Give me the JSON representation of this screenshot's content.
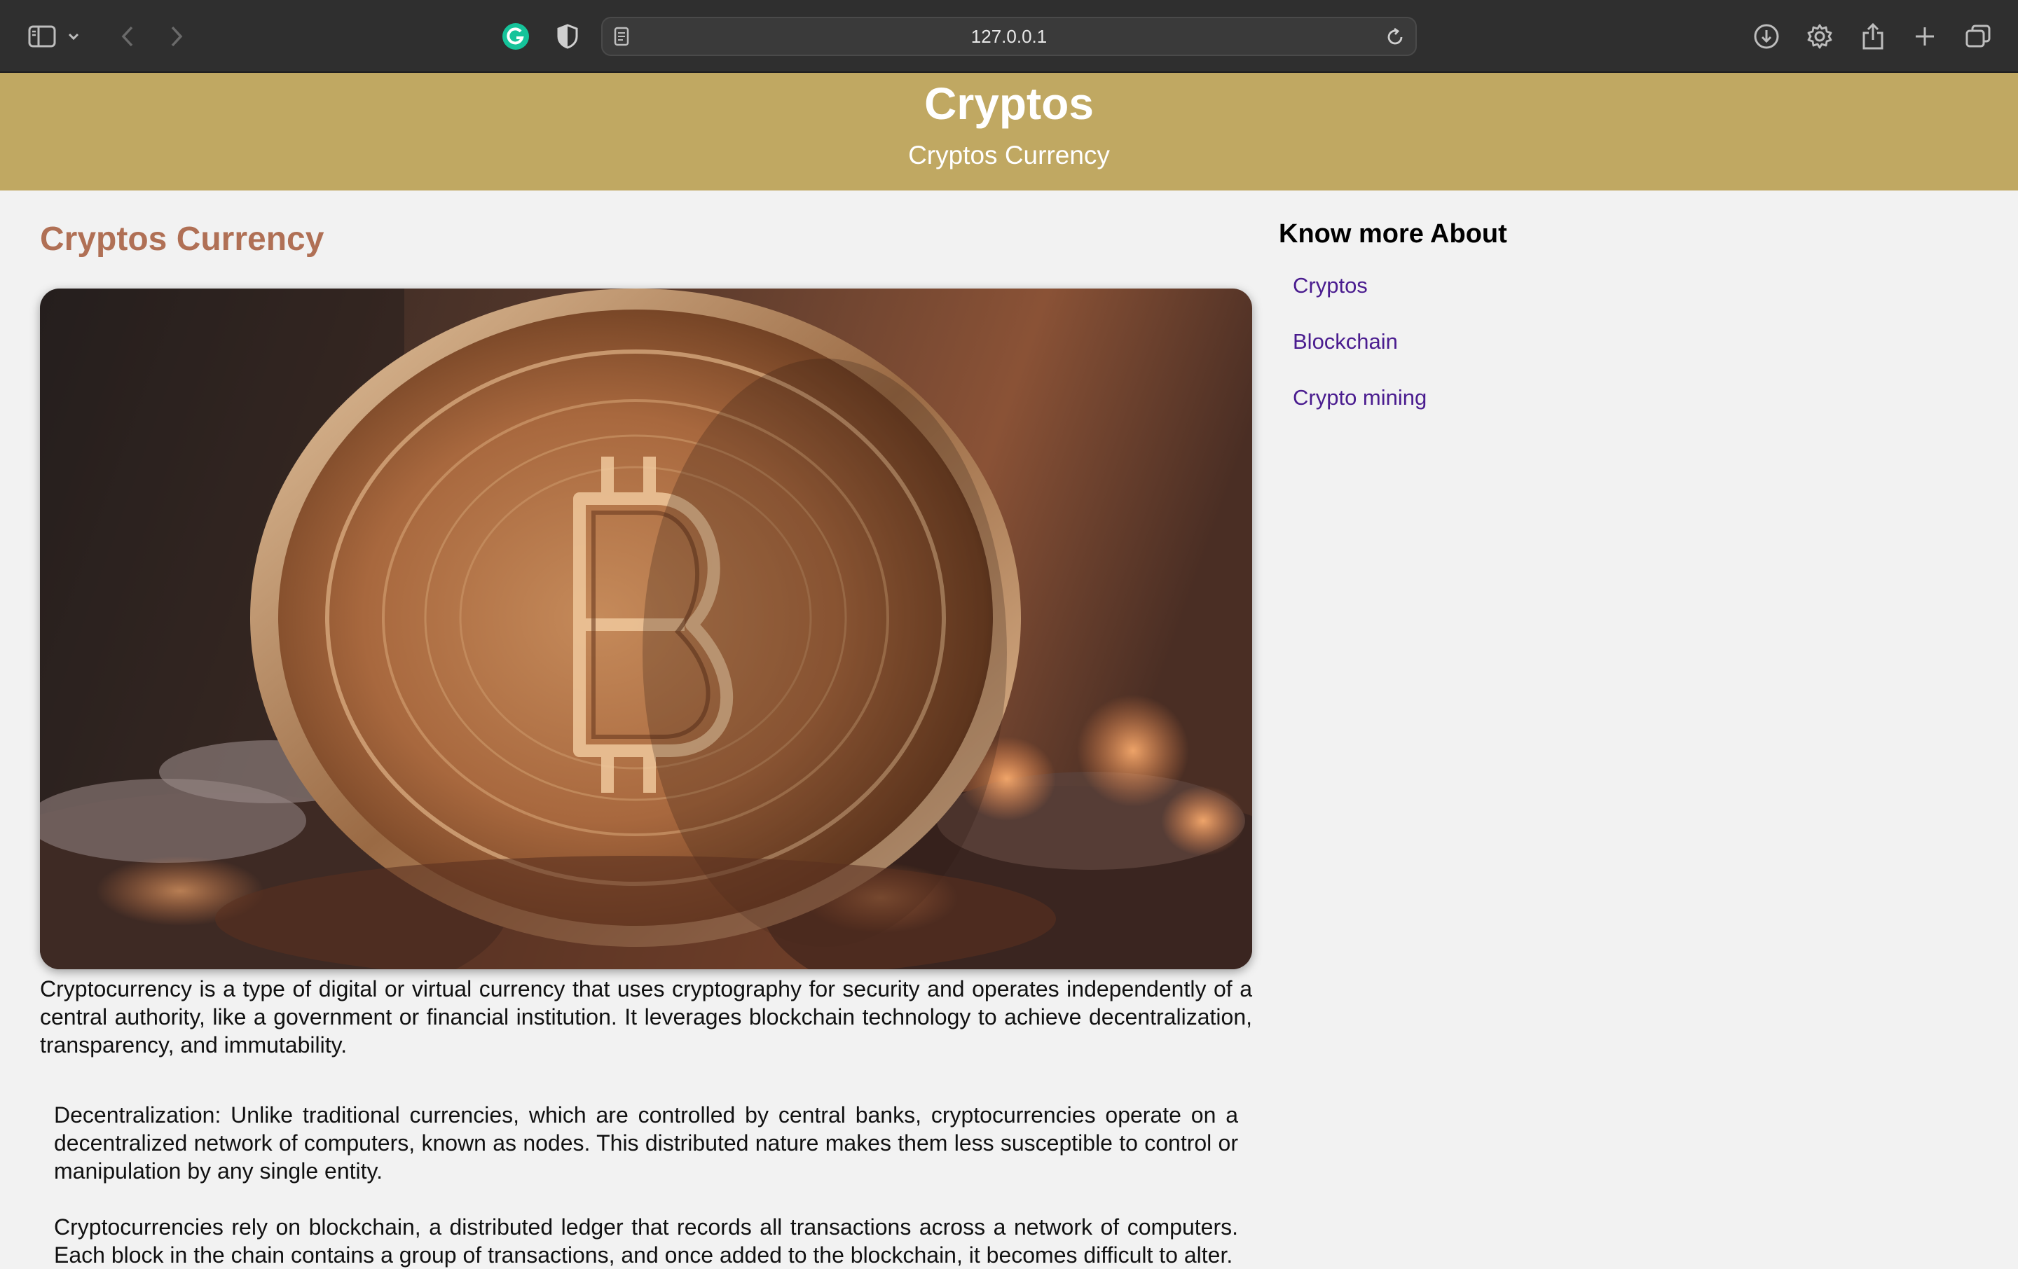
{
  "browser": {
    "url": "127.0.0.1",
    "icons": [
      "sidebar-icon",
      "chevron-down-icon",
      "back-arrow-icon",
      "forward-arrow-icon",
      "grammarly-icon",
      "shield-icon",
      "page-icon",
      "reload-icon",
      "download-icon",
      "gear-icon",
      "share-icon",
      "new-tab-icon",
      "tab-overview-icon"
    ],
    "colors": {
      "chrome": "#2f2f2f",
      "grammarly": "#15c39a"
    }
  },
  "header": {
    "title": "Cryptos",
    "subtitle": "Cryptos Currency",
    "background": "#c0a862"
  },
  "main": {
    "title": "Cryptos Currency",
    "title_color": "#b07055",
    "intro": "Cryptocurrency is a type of digital or virtual currency that uses cryptography for security and operates independently of a central authority, like a government or financial institution. It leverages blockchain technology to achieve decentralization, transparency, and immutability.",
    "points": [
      "Decentralization: Unlike traditional currencies, which are controlled by central banks, cryptocurrencies operate on a decentralized network of computers, known as nodes. This distributed nature makes them less susceptible to control or manipulation by any single entity.",
      "Cryptocurrencies rely on blockchain, a distributed ledger that records all transactions across a network of computers. Each block in the chain contains a group of transactions, and once added to the blockchain, it becomes difficult to alter."
    ]
  },
  "sidebar": {
    "heading": "Know more About",
    "links": [
      "Cryptos",
      "Blockchain",
      "Crypto mining"
    ],
    "link_color": "#4a1c8f"
  }
}
